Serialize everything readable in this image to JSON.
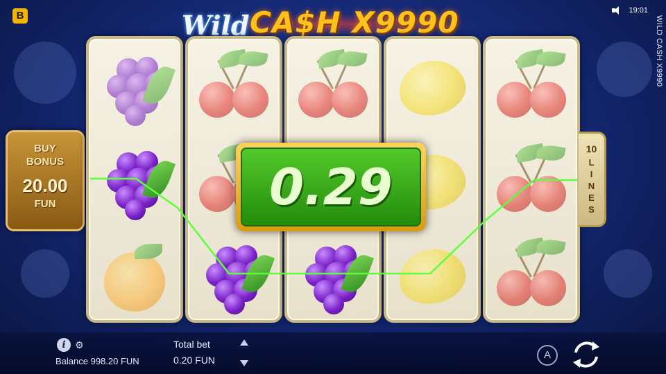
{
  "brand": {
    "badge": "B"
  },
  "logo": {
    "word1": "Wild",
    "word2": "CA$H X9990"
  },
  "status": {
    "time": "19:01",
    "sound_icon": "speaker-icon"
  },
  "side_title": "WILD CASH X9990",
  "buy_bonus": {
    "line1": "BUY",
    "line2": "BONUS",
    "price": "20.00",
    "currency": "FUN"
  },
  "win": {
    "amount": "0.29"
  },
  "lines": {
    "count": "10",
    "word": "LINES"
  },
  "reels": [
    [
      "grape",
      "grape",
      "orange"
    ],
    [
      "cherry",
      "cherry",
      "grape"
    ],
    [
      "cherry",
      "lemon",
      "grape"
    ],
    [
      "lemon",
      "lemon",
      "lemon"
    ],
    [
      "cherry",
      "cherry",
      "cherry"
    ]
  ],
  "winning_cells": [
    [
      0,
      1
    ],
    [
      1,
      2
    ],
    [
      2,
      2
    ]
  ],
  "footer": {
    "info_icon": "i",
    "balance_label": "Balance 998.20 FUN",
    "total_bet_label": "Total bet",
    "total_bet_value": "0.20 FUN",
    "auto_label": "A"
  },
  "colors": {
    "win_line": "#5cff3a",
    "win_panel": "#3aa81a",
    "accent_gold": "#f4b400"
  }
}
